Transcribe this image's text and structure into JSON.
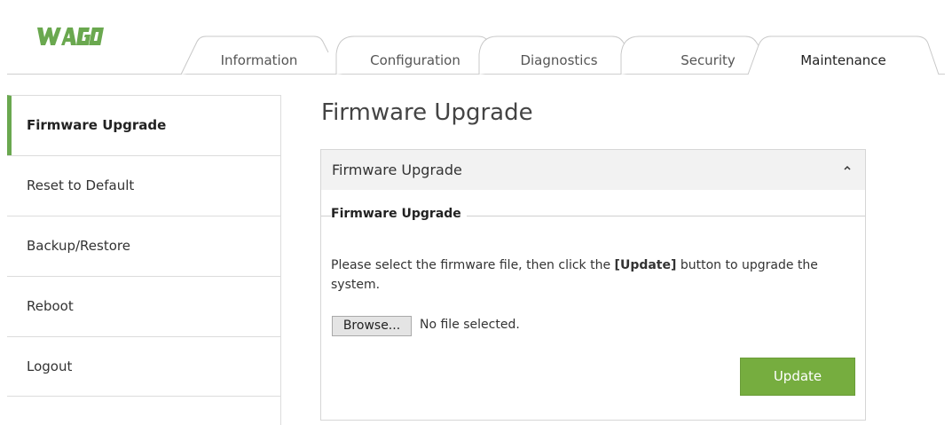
{
  "brand": {
    "logo_text": "WAGO",
    "logo_color": "#6aa84f"
  },
  "tabs": [
    {
      "label": "Information",
      "active": false
    },
    {
      "label": "Configuration",
      "active": false
    },
    {
      "label": "Diagnostics",
      "active": false
    },
    {
      "label": "Security",
      "active": false
    },
    {
      "label": "Maintenance",
      "active": true
    }
  ],
  "sidebar": {
    "items": [
      {
        "label": "Firmware Upgrade",
        "active": true
      },
      {
        "label": "Reset to Default",
        "active": false
      },
      {
        "label": "Backup/Restore",
        "active": false
      },
      {
        "label": "Reboot",
        "active": false
      },
      {
        "label": "Logout",
        "active": false
      }
    ]
  },
  "main": {
    "page_title": "Firmware Upgrade",
    "panel": {
      "title": "Firmware Upgrade",
      "collapse_icon": "chevron-up-icon",
      "legend": "Firmware Upgrade",
      "desc_before": "Please select the firmware file, then click the ",
      "desc_bold": "[Update]",
      "desc_after": " button to upgrade the system.",
      "browse_label": "Browse...",
      "file_status": "No file selected.",
      "update_label": "Update"
    }
  },
  "colors": {
    "accent": "#6aa84f",
    "update_button": "#76ad3f",
    "panel_header_bg": "#f2f2f2"
  }
}
